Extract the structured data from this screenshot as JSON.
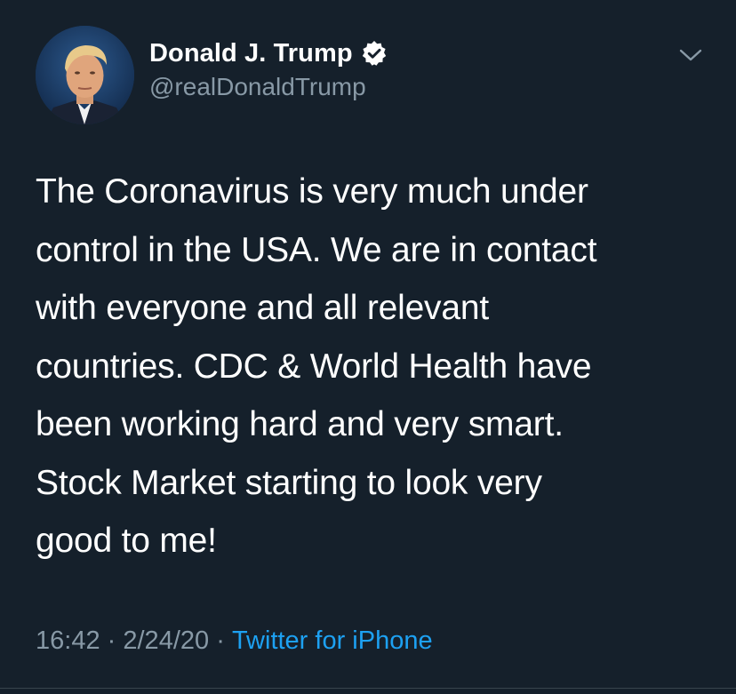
{
  "author": {
    "display_name": "Donald J. Trump",
    "handle": "@realDonaldTrump",
    "verified": true
  },
  "tweet": {
    "text": "The Coronavirus is very much under\ncontrol in the USA. We are in contact\nwith everyone and all relevant\ncountries. CDC & World Health have\nbeen working hard and very smart.\nStock Market starting to look very\ngood to me!",
    "time": "16:42",
    "separator": "·",
    "date": "2/24/20",
    "source": "Twitter for iPhone"
  },
  "icons": {
    "verified": "verified-badge-icon",
    "menu": "chevron-down-icon"
  },
  "colors": {
    "background": "#15202b",
    "text_primary": "#ffffff",
    "text_secondary": "#8899a6",
    "link": "#1da1f2",
    "divider": "#38444d"
  }
}
